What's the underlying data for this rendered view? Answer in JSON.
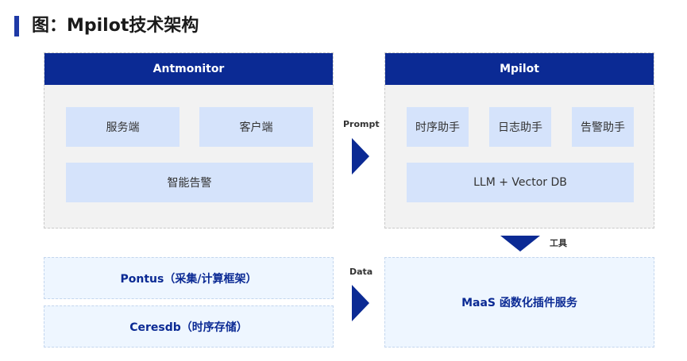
{
  "title": "图：Mpilot技术架构",
  "left_panel": {
    "header": "Antmonitor",
    "boxes": [
      "服务端",
      "客户端",
      "智能告警"
    ]
  },
  "right_panel": {
    "header": "Mpilot",
    "boxes": [
      "时序助手",
      "日志助手",
      "告警助手",
      "LLM + Vector DB"
    ]
  },
  "lower_left": [
    "Pontus（采集/计算框架）",
    "Ceresdb（时序存储）"
  ],
  "lower_right": "MaaS 函数化插件服务",
  "arrows": {
    "prompt": "Prompt",
    "data": "Data",
    "tools": "工具"
  },
  "colors": {
    "header": "#0b2a94",
    "box": "#d5e3fb",
    "lane": "#eef6ff",
    "panel": "#f2f2f2",
    "accent": "#1f3aa6"
  }
}
